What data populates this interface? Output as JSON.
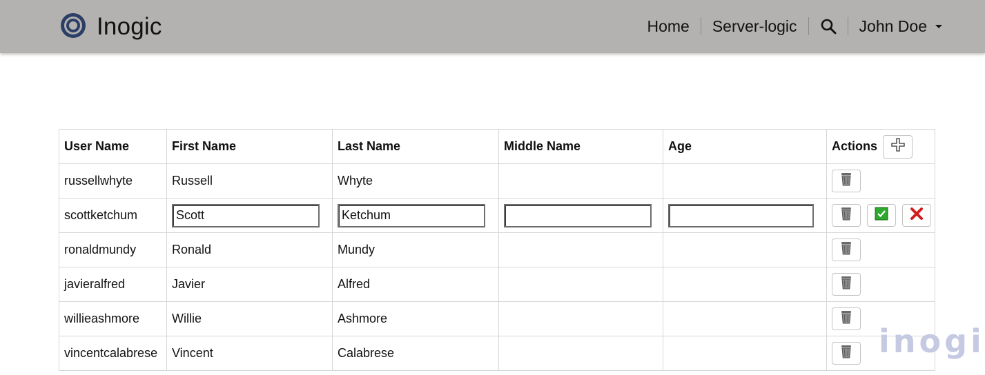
{
  "brand": {
    "name": "Inogic",
    "logo_icon": "inogic-ring-logo"
  },
  "nav": {
    "links": [
      {
        "label": "Home"
      },
      {
        "label": "Server-logic"
      }
    ],
    "search_icon": "search-icon",
    "user": {
      "name": "John Doe",
      "icon": "caret-down-icon"
    }
  },
  "table": {
    "headers": {
      "user_name": "User Name",
      "first_name": "First Name",
      "last_name": "Last Name",
      "middle_name": "Middle Name",
      "age": "Age",
      "actions": "Actions"
    },
    "rows": [
      {
        "user_name": "russellwhyte",
        "first_name": "Russell",
        "last_name": "Whyte",
        "middle_name": "",
        "age": ""
      },
      {
        "user_name": "scottketchum",
        "first_name": "Scott",
        "last_name": "Ketchum",
        "middle_name": "",
        "age": "",
        "editing": true
      },
      {
        "user_name": "ronaldmundy",
        "first_name": "Ronald",
        "last_name": "Mundy",
        "middle_name": "",
        "age": ""
      },
      {
        "user_name": "javieralfred",
        "first_name": "Javier",
        "last_name": "Alfred",
        "middle_name": "",
        "age": ""
      },
      {
        "user_name": "willieashmore",
        "first_name": "Willie",
        "last_name": "Ashmore",
        "middle_name": "",
        "age": ""
      },
      {
        "user_name": "vincentcalabrese",
        "first_name": "Vincent",
        "last_name": "Calabrese",
        "middle_name": "",
        "age": ""
      }
    ],
    "icons": {
      "add": "plus-icon",
      "delete": "trash-icon",
      "save": "check-icon",
      "cancel": "close-icon"
    }
  },
  "watermark": {
    "text": "inogic"
  },
  "colors": {
    "navbar_bg": "#b3b2b0",
    "save_green": "#2ea82e",
    "cancel_red": "#d11c1c",
    "watermark": "#c5c9e2"
  }
}
